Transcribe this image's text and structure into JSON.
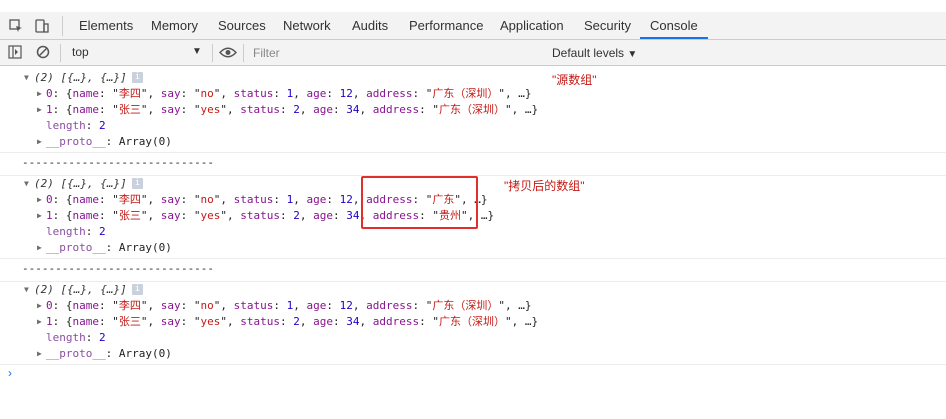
{
  "tabs": [
    "Elements",
    "Memory",
    "Sources",
    "Network",
    "Audits",
    "Performance",
    "Application",
    "Security",
    "Console"
  ],
  "active_tab": "Console",
  "toolbar": {
    "context": "top",
    "filter_placeholder": "Filter",
    "levels_label": "Default levels"
  },
  "icons": [
    "inspect-element-icon",
    "device-toolbar-icon",
    "sidebar-toggle-icon",
    "clear-console-icon",
    "eye-icon"
  ],
  "colors": {
    "highlight_box": "#e0302c",
    "active_tab_underline": "#1a73e8"
  },
  "console": {
    "groups": [
      {
        "summary": "(2) [{…}, {…}]",
        "note": "\"源数组\"",
        "items": [
          {
            "index": "0",
            "name": "李四",
            "say": "no",
            "status": "1",
            "age": "12",
            "address": "广东（深圳）"
          },
          {
            "index": "1",
            "name": "张三",
            "say": "yes",
            "status": "2",
            "age": "34",
            "address": "广东（深圳）"
          }
        ],
        "length": "2",
        "proto": "Array(0)"
      },
      {
        "summary": "(2) [{…}, {…}]",
        "note": "\"拷贝后的数组\"",
        "items": [
          {
            "index": "0",
            "name": "李四",
            "say": "no",
            "status": "1",
            "age": "12",
            "address": "广东"
          },
          {
            "index": "1",
            "name": "张三",
            "say": "yes",
            "status": "2",
            "age": "34",
            "address": "贵州"
          }
        ],
        "length": "2",
        "proto": "Array(0)"
      },
      {
        "summary": "(2) [{…}, {…}]",
        "note": "",
        "items": [
          {
            "index": "0",
            "name": "李四",
            "say": "no",
            "status": "1",
            "age": "12",
            "address": "广东（深圳）"
          },
          {
            "index": "1",
            "name": "张三",
            "say": "yes",
            "status": "2",
            "age": "34",
            "address": "广东（深圳）"
          }
        ],
        "length": "2",
        "proto": "Array(0)"
      }
    ],
    "separator": "-----------------------------",
    "labels": {
      "name": "name",
      "say": "say",
      "status": "status",
      "age": "age",
      "address": "address",
      "length": "length",
      "proto": "__proto__",
      "ellipsis": "…"
    },
    "prompt": "›"
  }
}
